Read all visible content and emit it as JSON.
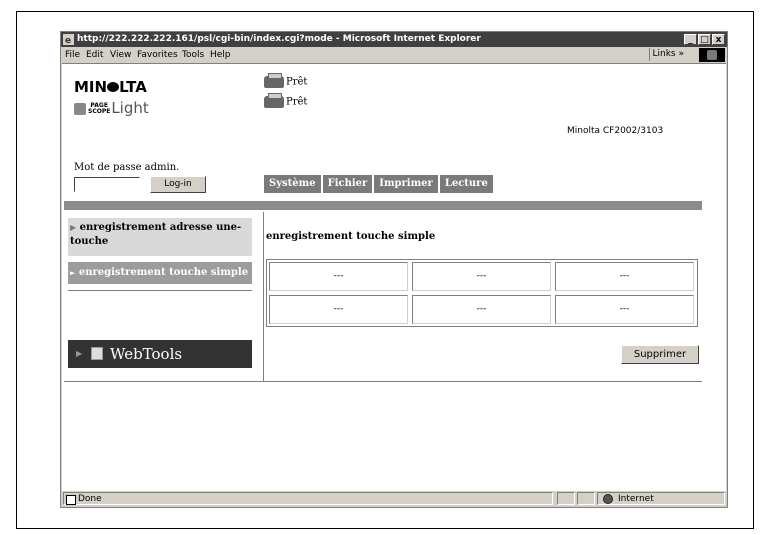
{
  "window": {
    "title": "http://222.222.222.161/psl/cgi-bin/index.cgi?mode - Microsoft Internet Explorer",
    "controls": [
      "_",
      "□",
      "x"
    ]
  },
  "menu": {
    "items": [
      "File",
      "Edit",
      "View",
      "Favorites",
      "Tools",
      "Help"
    ],
    "links_label": "Links »"
  },
  "header": {
    "logo_pre": "MIN",
    "logo_post": "LTA",
    "pagescope_top": "PAGE",
    "pagescope_bottom": "SCOPE",
    "pagescope_light": "Light",
    "status": [
      "Prêt",
      "Prêt"
    ],
    "model": "Minolta CF2002/3103"
  },
  "login": {
    "label": "Mot de passe admin.",
    "password_value": "",
    "button": "Log-in"
  },
  "tabs": [
    "Système",
    "Fichier",
    "Imprimer",
    "Lecture"
  ],
  "sidebar": {
    "items": [
      {
        "label": "enregistrement adresse une-touche",
        "selected": false
      },
      {
        "label": "enregistrement touche simple",
        "selected": true
      }
    ],
    "webtools": "WebTools"
  },
  "main": {
    "title": "enregistrement touche simple",
    "grid": [
      [
        "---",
        "---",
        "---"
      ],
      [
        "---",
        "---",
        "---"
      ]
    ],
    "delete_button": "Supprimer"
  },
  "statusbar": {
    "text": "Done",
    "zone": "Internet"
  }
}
